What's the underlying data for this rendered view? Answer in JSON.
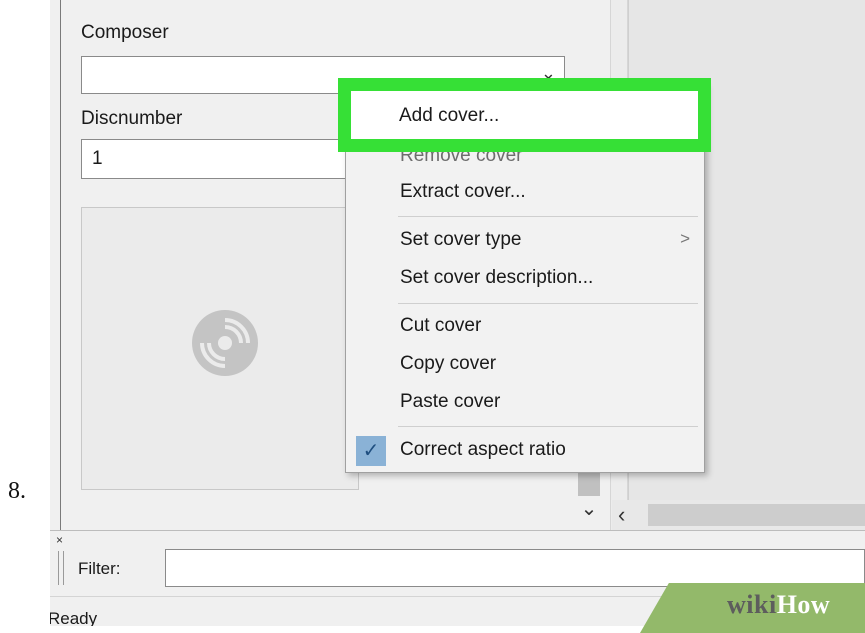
{
  "step_number": "8.",
  "fields": {
    "composer_label": "Composer",
    "composer_value": "",
    "discnumber_label": "Discnumber",
    "discnumber_value": "1"
  },
  "context_menu": {
    "items": [
      {
        "label": "Add cover...",
        "state": "highlighted"
      },
      {
        "label": "Remove cover",
        "state": "partially-obscured"
      },
      {
        "label": "Extract cover...",
        "state": "normal"
      },
      {
        "label": "Set cover type",
        "state": "normal",
        "has_submenu": true
      },
      {
        "label": "Set cover description...",
        "state": "normal"
      },
      {
        "label": "Cut cover",
        "state": "normal"
      },
      {
        "label": "Copy cover",
        "state": "normal"
      },
      {
        "label": "Paste cover",
        "state": "normal"
      },
      {
        "label": "Correct aspect ratio",
        "state": "checked"
      }
    ],
    "submenu_arrow": ">",
    "check_mark": "✓"
  },
  "filter": {
    "label": "Filter:",
    "value": "",
    "close_glyph": "×"
  },
  "status": {
    "text": "Ready"
  },
  "watermark": {
    "wiki": "wiki",
    "how": "How"
  },
  "icons": {
    "combo_arrow": "chevron-down-icon",
    "disc": "cd-disc-icon",
    "scroll_down": "chevron-down-icon",
    "scroll_left": "chevron-left-icon"
  },
  "colors": {
    "highlight_border": "#36e036",
    "check_background": "#8ab2d6",
    "watermark_green": "#93b96a"
  }
}
